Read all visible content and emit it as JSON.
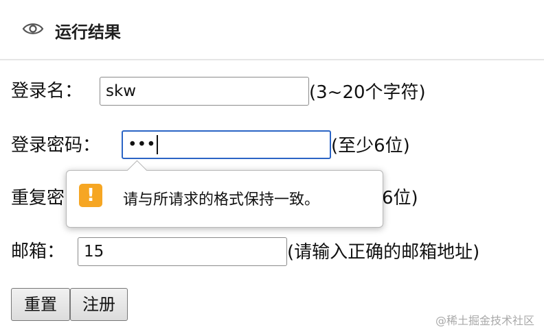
{
  "header": {
    "title": "运行结果",
    "icon": "eye-icon"
  },
  "form": {
    "login_name": {
      "label": "登录名：",
      "value": "skw",
      "hint": "(3~20个字符)"
    },
    "password": {
      "label": "登录密码：",
      "value": "•••",
      "hint": "(至少6位)"
    },
    "repeat_password": {
      "label": "重复密",
      "hint": "6位)"
    },
    "email": {
      "label": "邮箱：",
      "value": "15",
      "hint": "(请输入正确的邮箱地址)"
    }
  },
  "buttons": {
    "reset": "重置",
    "register": "注册"
  },
  "tooltip": {
    "icon": "warning-icon",
    "icon_glyph": "!",
    "message": "请与所请求的格式保持一致。",
    "icon_color": "#f6a623"
  },
  "watermark": "@稀土掘金技术社区",
  "colors": {
    "focus_border": "#2a64c5"
  }
}
